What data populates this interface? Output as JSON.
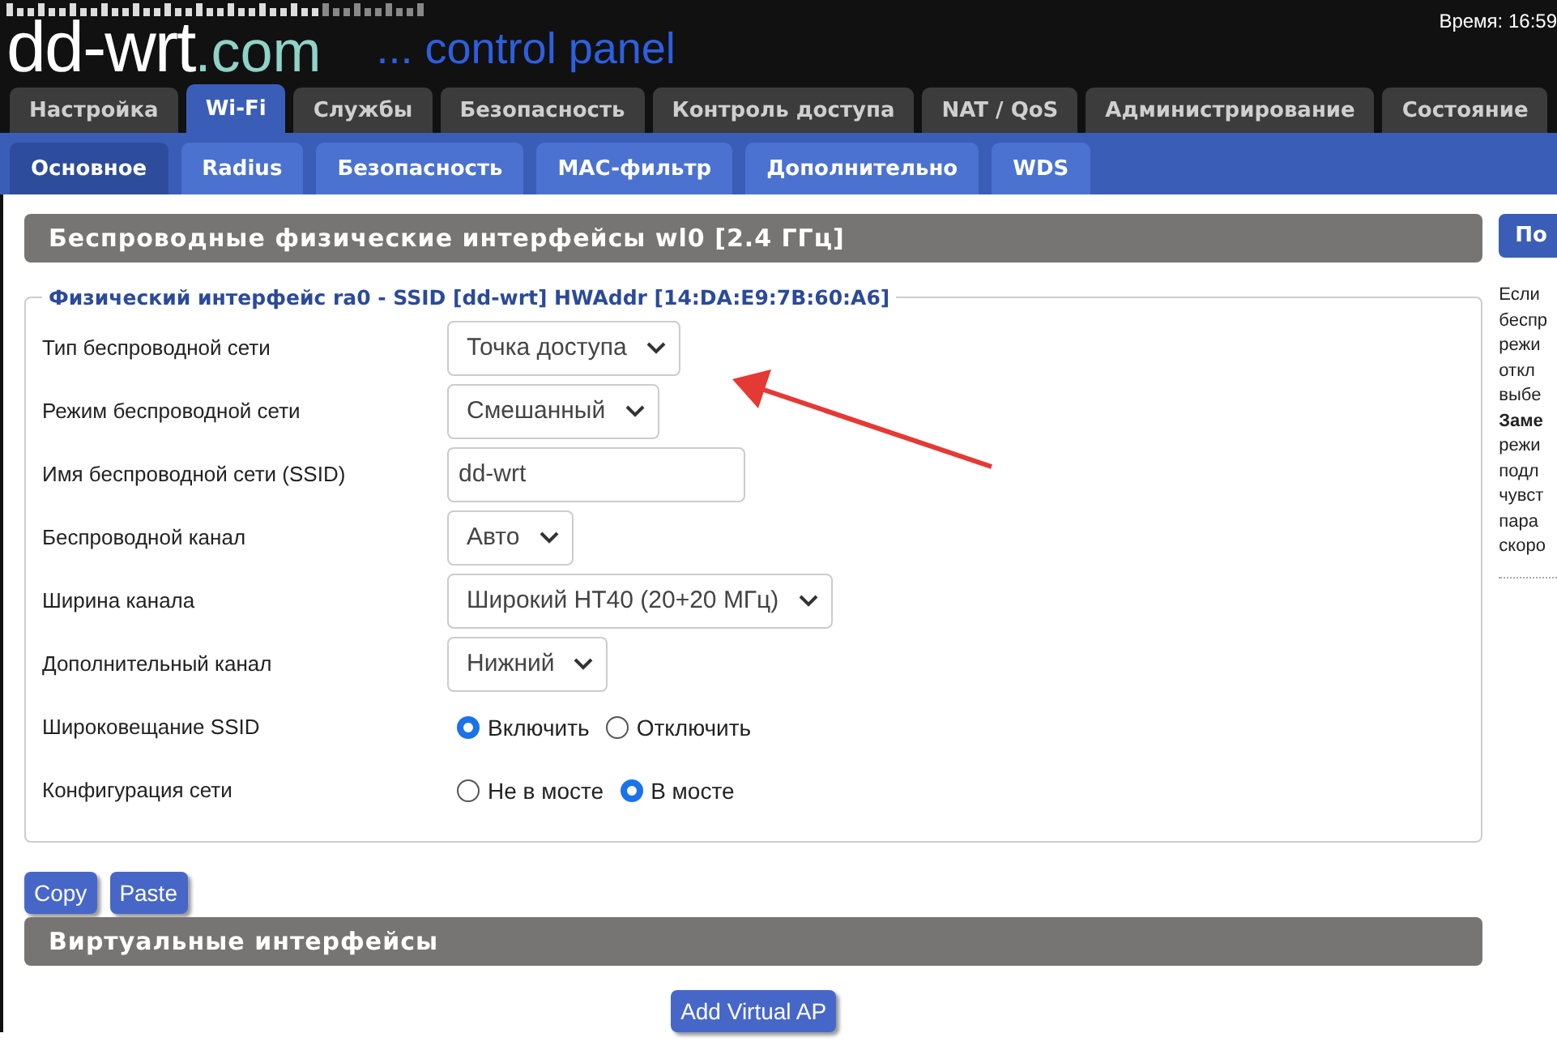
{
  "header": {
    "logo_main": "dd-wrt",
    "logo_suffix": ".com",
    "tagline": "... control panel",
    "time": "Время: 16:59"
  },
  "tabs": [
    {
      "label": "Настройка",
      "selected": false
    },
    {
      "label": "Wi-Fi",
      "selected": true
    },
    {
      "label": "Службы",
      "selected": false
    },
    {
      "label": "Безопасность",
      "selected": false
    },
    {
      "label": "Контроль доступа",
      "selected": false
    },
    {
      "label": "NAT / QoS",
      "selected": false
    },
    {
      "label": "Администрирование",
      "selected": false
    },
    {
      "label": "Состояние",
      "selected": false
    }
  ],
  "subtabs": [
    {
      "label": "Основное",
      "selected": true
    },
    {
      "label": "Radius",
      "selected": false
    },
    {
      "label": "Безопасность",
      "selected": false
    },
    {
      "label": "MAC-фильтр",
      "selected": false
    },
    {
      "label": "Дополнительно",
      "selected": false
    },
    {
      "label": "WDS",
      "selected": false
    }
  ],
  "section_title": "Беспроводные физические интерфейсы wl0 [2.4 ГГц]",
  "fieldset_legend": "Физический интерфейс ra0 - SSID [dd-wrt] HWAddr [14:DA:E9:7B:60:A6]",
  "fields": [
    {
      "kind": "select",
      "label": "Тип беспроводной сети",
      "value": "Точка доступа"
    },
    {
      "kind": "select",
      "label": "Режим беспроводной сети",
      "value": "Смешанный"
    },
    {
      "kind": "text",
      "label": "Имя беспроводной сети (SSID)",
      "value": "dd-wrt"
    },
    {
      "kind": "select",
      "label": "Беспроводной канал",
      "value": "Авто"
    },
    {
      "kind": "select",
      "label": "Ширина канала",
      "value": "Широкий HT40 (20+20 МГц)"
    },
    {
      "kind": "select",
      "label": "Дополнительный канал",
      "value": "Нижний"
    },
    {
      "kind": "radio",
      "label": "Широковещание SSID",
      "options": [
        {
          "label": "Включить",
          "selected": true
        },
        {
          "label": "Отключить",
          "selected": false
        }
      ]
    },
    {
      "kind": "radio",
      "label": "Конфигурация сети",
      "options": [
        {
          "label": "Не в мосте",
          "selected": false
        },
        {
          "label": "В мосте",
          "selected": true
        }
      ]
    }
  ],
  "copy_buttons": [
    "Copy",
    "Paste"
  ],
  "virtual_title": "Виртуальные интерфейсы",
  "add_button": "Add Virtual AP",
  "help": {
    "title": "По",
    "lines": [
      {
        "text": "Если",
        "bold": false
      },
      {
        "text": "беспр",
        "bold": false
      },
      {
        "text": "режи",
        "bold": false
      },
      {
        "text": "откл",
        "bold": false
      },
      {
        "text": "выбе",
        "bold": false
      },
      {
        "text": "Заме",
        "bold": true
      },
      {
        "text": "режи",
        "bold": false
      },
      {
        "text": "подл",
        "bold": false
      },
      {
        "text": "чувст",
        "bold": false
      },
      {
        "text": "пара",
        "bold": false
      },
      {
        "text": "скоро",
        "bold": false
      }
    ]
  }
}
